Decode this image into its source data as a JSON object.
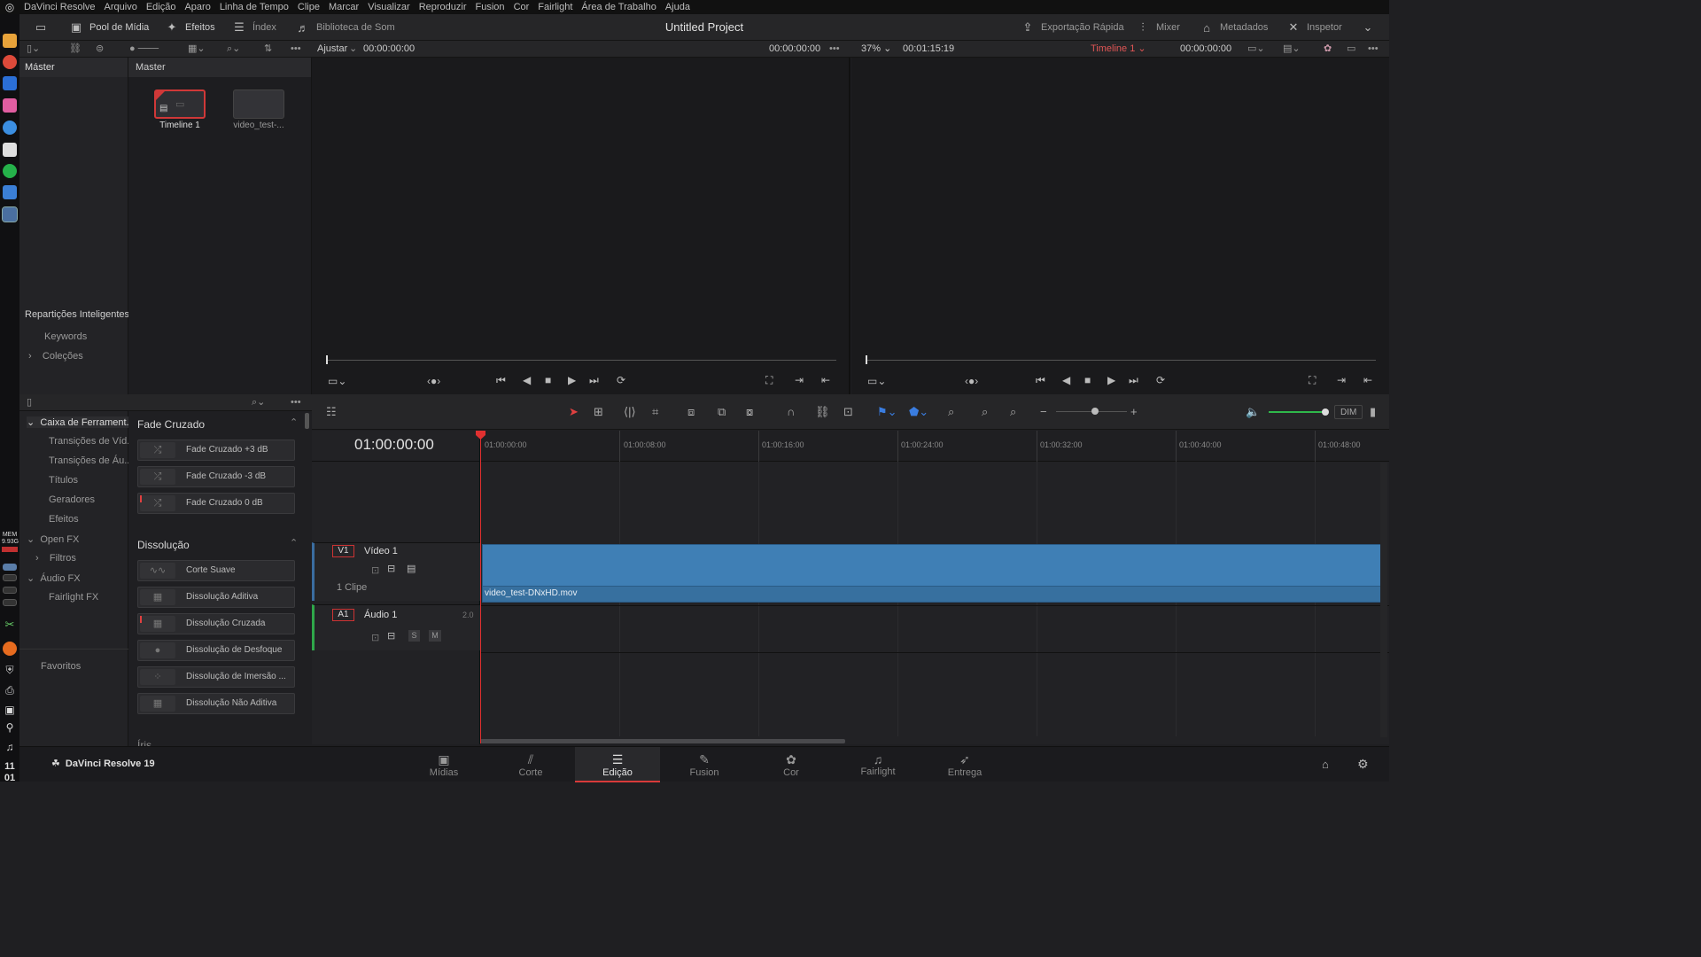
{
  "menu": [
    "DaVinci Resolve",
    "Arquivo",
    "Edição",
    "Aparo",
    "Linha de Tempo",
    "Clipe",
    "Marcar",
    "Visualizar",
    "Reproduzir",
    "Fusion",
    "Cor",
    "Fairlight",
    "Área de Trabalho",
    "Ajuda"
  ],
  "toolbar": {
    "media_pool": "Pool de Mídia",
    "effects": "Efeitos",
    "index": "Índex",
    "sound_library": "Biblioteca de Som",
    "project_title": "Untitled Project",
    "quick_export": "Exportação Rápida",
    "mixer": "Mixer",
    "metadata": "Metadados",
    "inspector": "Inspetor"
  },
  "source_viewer": {
    "zoom": "Ajustar",
    "timecode_left": "00:00:00:00",
    "timecode_right": "00:00:00:00"
  },
  "timeline_viewer": {
    "zoom": "37%",
    "duration": "00:01:15:19",
    "timeline_name": "Timeline 1",
    "timecode": "00:00:00:00"
  },
  "bins": {
    "master": "Máster",
    "smart_bins": "Repartições Inteligentes",
    "keywords": "Keywords",
    "collections": "Coleções"
  },
  "pool": {
    "header": "Master",
    "items": [
      {
        "label": "Timeline 1"
      },
      {
        "label": "video_test-..."
      }
    ]
  },
  "fx_tree": {
    "toolbox": "Caixa de Ferrament...",
    "video_transitions": "Transições de Víd...",
    "audio_transitions": "Transições de Áu...",
    "titles": "Títulos",
    "generators": "Geradores",
    "effects": "Efeitos",
    "open_fx": "Open FX",
    "filters": "Filtros",
    "audio_fx": "Áudio FX",
    "fairlight_fx": "Fairlight FX",
    "favorites": "Favoritos"
  },
  "fx_list": {
    "crossfade_header": "Fade Cruzado",
    "crossfade_items": [
      "Fade Cruzado +3 dB",
      "Fade Cruzado -3 dB",
      "Fade Cruzado 0 dB"
    ],
    "dissolve_header": "Dissolução",
    "dissolve_items": [
      "Corte Suave",
      "Dissolução Aditiva",
      "Dissolução Cruzada",
      "Dissolução de Desfoque",
      "Dissolução de Imersão ...",
      "Dissolução Não Aditiva"
    ],
    "iris_header": "Íris"
  },
  "timeline": {
    "timecode": "01:00:00:00",
    "ruler": [
      "01:00:00:00",
      "01:00:08:00",
      "01:00:16:00",
      "01:00:24:00",
      "01:00:32:00",
      "01:00:40:00",
      "01:00:48:00"
    ],
    "dim": "DIM",
    "video_track": {
      "id": "V1",
      "name": "Vídeo 1",
      "clips": "1 Clipe"
    },
    "audio_track": {
      "id": "A1",
      "name": "Áudio 1",
      "channels": "2.0",
      "solo": "S",
      "mute": "M"
    },
    "clip_name": "video_test-DNxHD.mov"
  },
  "pages": [
    "Mídias",
    "Corte",
    "Edição",
    "Fusion",
    "Cor",
    "Fairlight",
    "Entrega"
  ],
  "app_brand": "DaVinci Resolve 19",
  "dock": {
    "mem": "MEM",
    "mem_value": "9.93G",
    "clock_h": "11",
    "clock_m": "01"
  },
  "colors": {
    "accent_red": "#e03030",
    "clip_blue": "#3f7fb5"
  }
}
